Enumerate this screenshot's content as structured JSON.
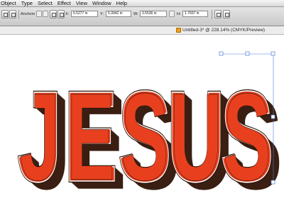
{
  "menubar": {
    "items": [
      "Object",
      "Type",
      "Select",
      "Effect",
      "View",
      "Window",
      "Help"
    ]
  },
  "controlbar": {
    "anchors_label": "Anchors",
    "x_label": "X:",
    "x_value": "6.5277 in",
    "y_label": "Y:",
    "y_value": "5.3942 in",
    "w_label": "W:",
    "w_value": "3.5536 in",
    "h_label": "H:",
    "h_value": "1.7607 in"
  },
  "document": {
    "title": "Untitled-3* @ 228.14% (CMYK/Preview)"
  },
  "artwork": {
    "text": "JESUS",
    "letters": [
      "J",
      "E",
      "S",
      "U",
      "S"
    ],
    "colors": {
      "fill": "#e8401f",
      "shadow": "#3a1f12",
      "outline": "#2a140a",
      "inline": "#ffffff",
      "selection": "#4a7bd8"
    }
  }
}
